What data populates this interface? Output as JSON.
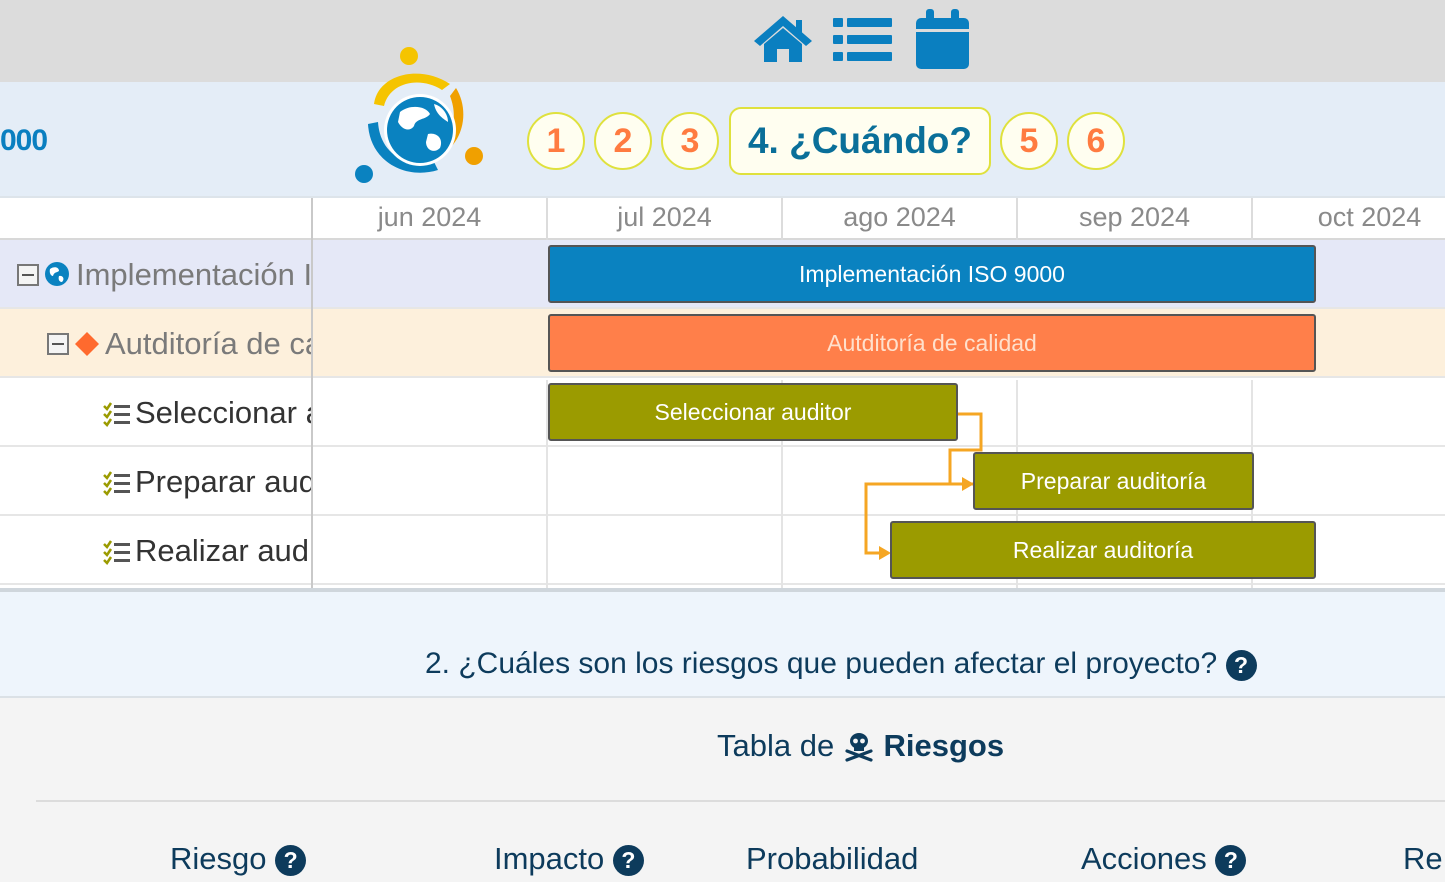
{
  "toolbar": {
    "icons": [
      "home-icon",
      "list-icon",
      "calendar-icon"
    ],
    "color": "#0a7fc0"
  },
  "project": {
    "name_fragment": "000"
  },
  "steps": [
    {
      "label": "1"
    },
    {
      "label": "2"
    },
    {
      "label": "3"
    },
    {
      "label": "4. ¿Cuándo?"
    },
    {
      "label": "5"
    },
    {
      "label": "6"
    }
  ],
  "gantt": {
    "months": [
      "jun 2024",
      "jul 2024",
      "ago 2024",
      "sep 2024",
      "oct 2024"
    ],
    "tasks": [
      {
        "name": "Implementación ISO 9000",
        "bar_label": "Implementación ISO 9000",
        "color": "#0a82c0",
        "row_bg": "#e5e8f7",
        "text_color": "#7a7a7a"
      },
      {
        "name": "Autditoría de calidad",
        "bar_label": "Autditoría de calidad",
        "color": "#ff7f4a",
        "row_bg": "#fdf0dc",
        "text_color": "#7a7a7a"
      },
      {
        "name": "Seleccionar auditor",
        "bar_label": "Seleccionar auditor",
        "color": "#9b9b00",
        "row_bg": "#ffffff",
        "text_color": "#333333"
      },
      {
        "name": "Preparar auditoría",
        "bar_label": "Preparar auditoría",
        "color": "#9b9b00",
        "row_bg": "#ffffff",
        "text_color": "#333333"
      },
      {
        "name": "Realizar auditoría",
        "bar_label": "Realizar auditoría",
        "color": "#9b9b00",
        "row_bg": "#ffffff",
        "text_color": "#333333"
      }
    ],
    "dependency_color": "#f5a623"
  },
  "risks": {
    "question": "2. ¿Cuáles son los riesgos que pueden afectar el proyecto?",
    "table_title_prefix": "Tabla de",
    "table_title_bold": "Riesgos",
    "columns": [
      "Riesgo",
      "Impacto",
      "Probabilidad",
      "Acciones",
      "Re"
    ]
  }
}
